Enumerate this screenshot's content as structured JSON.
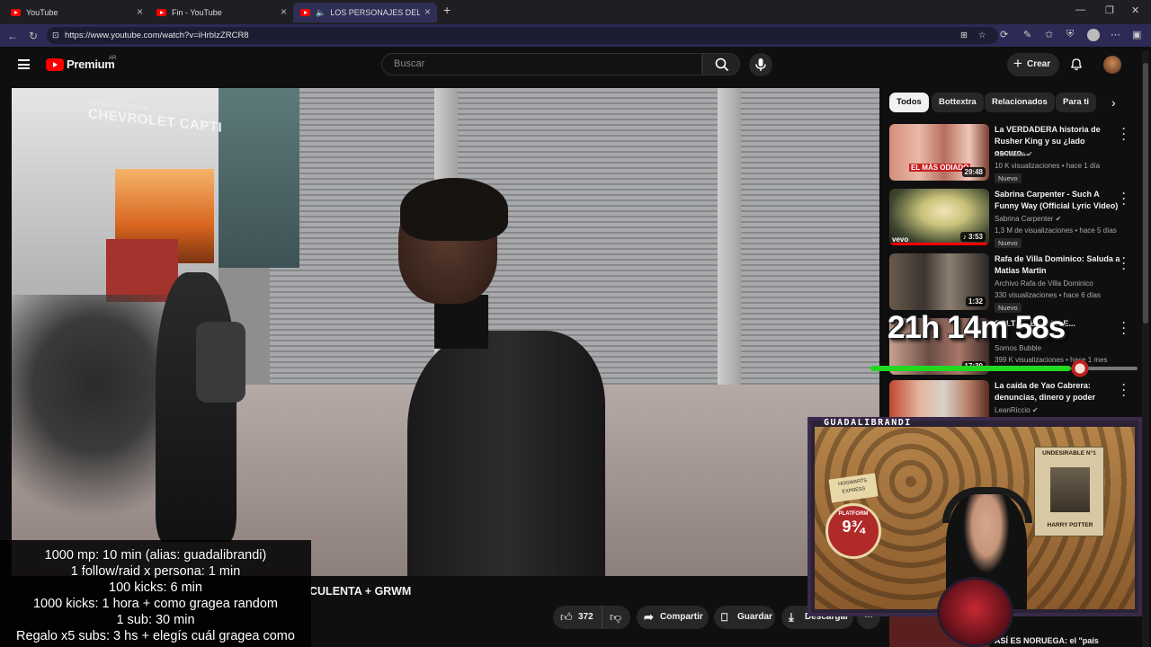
{
  "browser": {
    "tabs": [
      {
        "label": "YouTube"
      },
      {
        "label": "Fin - YouTube"
      },
      {
        "label": "LOS PERSONAJES DEL AÑO S"
      }
    ],
    "url": "https://www.youtube.com/watch?v=iHrblzZRCR8"
  },
  "header": {
    "logo_text": "Premium",
    "country": "AR",
    "search_placeholder": "Buscar",
    "create_label": "Crear"
  },
  "video": {
    "title_visible": "CULENTA + GRWM",
    "sign_top": "PERSONAJES DEL AÑO",
    "sign_text": "CHEVROLET CAPTI",
    "likes": "372",
    "share_label": "Compartir",
    "save_label": "Guardar",
    "download_label": "Descargar"
  },
  "chips": [
    "Todos",
    "Bottextra",
    "Relacionados",
    "Para ti"
  ],
  "recommendations": [
    {
      "title": "La VERDADERA historia de Rusher King y su ¿lado oscuro...",
      "channel": "Ale Marin",
      "meta": "10 K visualizaciones • hace 1 día",
      "badge": "Nuevo",
      "duration": "29:48",
      "thumb_text": "EL MÁS ODIADO"
    },
    {
      "title": "Sabrina Carpenter - Such A Funny Way (Official Lyric Video)",
      "channel": "Sabrina Carpenter",
      "meta": "1,3 M de visualizaciones • hace 5 días",
      "badge": "Nuevo",
      "duration": "3:53",
      "thumb_text": "vevo"
    },
    {
      "title": "Rafa de Villa Dominico: Saluda a Matias Martin",
      "channel": "Archivo Rafa de Villa Dominico",
      "meta": "330 visualizaciones • hace 6 días",
      "badge": "Nuevo",
      "duration": "1:32"
    },
    {
      "title": "SOLTE... ENAN R E...",
      "channel": "Somos Bubble",
      "meta": "399 K visualizaciones • hace 1 mes",
      "duration": "17:30"
    },
    {
      "title": "La caída de Yao Cabrera: denuncias, dinero y poder",
      "channel": "LeanRiccio",
      "meta": ""
    },
    {
      "title": "ASÍ ES NORUEGA: el \"país",
      "channel": "",
      "meta": ""
    }
  ],
  "stream": {
    "timer": "21h 14m 58s",
    "timer_progress": 0.75,
    "cam_name": "GUADALIBRANDI",
    "goals": [
      "1000 mp: 10 min (alias: guadalibrandi)",
      "1 follow/raid x persona: 1 min",
      "100 kicks: 6 min",
      "1000 kicks: 1 hora + como gragea random",
      "1 sub: 30 min",
      "Regalo x5 subs: 3 hs + elegís cuál gragea como"
    ],
    "poster_text": "UNDESIRABLE N°1",
    "poster_name": "HARRY POTTER",
    "platform_label": "PLATFORM",
    "platform_number": "9¾",
    "hogwarts_label": "HOGWARTS EXPRESS"
  },
  "colors": {
    "accent": "#ff0000",
    "timer_bar": "#22d922",
    "page_bg": "#0f0f0f"
  }
}
